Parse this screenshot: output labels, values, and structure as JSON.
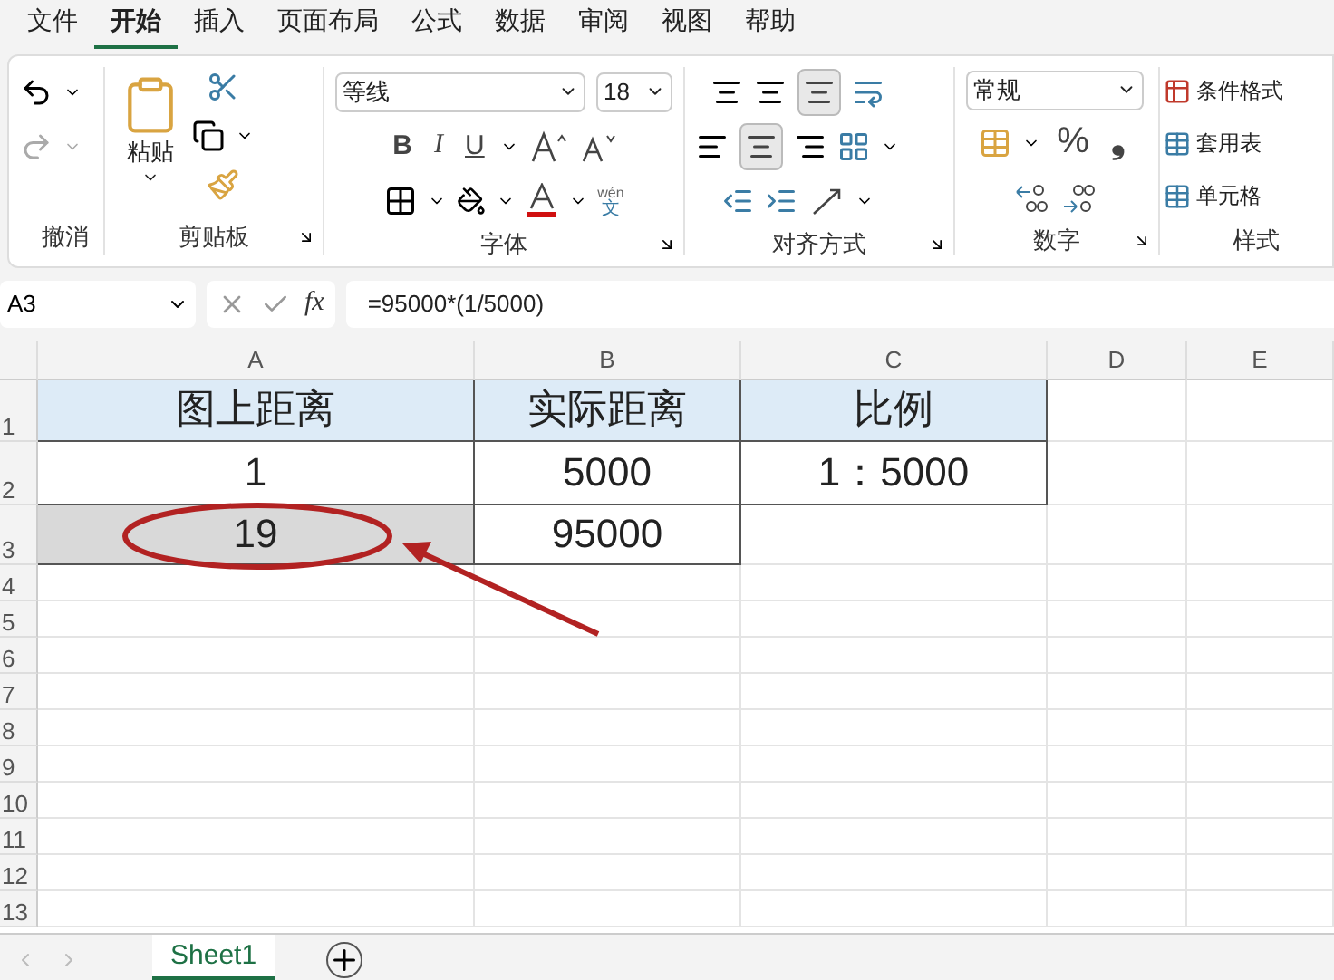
{
  "menu_tabs": [
    {
      "label": "文件",
      "selected": false
    },
    {
      "label": "开始",
      "selected": true
    },
    {
      "label": "插入",
      "selected": false
    },
    {
      "label": "页面布局",
      "selected": false
    },
    {
      "label": "公式",
      "selected": false
    },
    {
      "label": "数据",
      "selected": false
    },
    {
      "label": "审阅",
      "selected": false
    },
    {
      "label": "视图",
      "selected": false
    },
    {
      "label": "帮助",
      "selected": false
    }
  ],
  "ribbon": {
    "undo_group": "撤消",
    "clipboard": {
      "paste": "粘贴",
      "label": "剪贴板"
    },
    "font": {
      "name": "等线",
      "size": "18",
      "bold": "B",
      "italic": "I",
      "underline": "U",
      "phonetic_top": "wén",
      "phonetic_bottom": "文",
      "label": "字体"
    },
    "alignment": {
      "label": "对齐方式"
    },
    "number": {
      "format": "常规",
      "percent": "%",
      "comma": "❟",
      "label": "数字"
    },
    "styles": {
      "items": [
        "条件格式",
        "套用表",
        "单元格"
      ],
      "label": "样式"
    }
  },
  "formula_bar": {
    "name_box": "A3",
    "fx": "fx",
    "formula": "=95000*(1/5000)"
  },
  "sheet": {
    "columns": [
      "A",
      "B",
      "C",
      "D",
      "E"
    ],
    "rows": [
      {
        "number": "1",
        "header": true,
        "cells": [
          {
            "text": "图上距离",
            "selected": false
          },
          {
            "text": "实际距离",
            "selected": false
          },
          {
            "text": "比例",
            "selected": false
          }
        ]
      },
      {
        "number": "2",
        "cells": [
          {
            "text": "1",
            "selected": false
          },
          {
            "text": "5000",
            "selected": false
          },
          {
            "text": "1：5000",
            "selected": false
          }
        ]
      },
      {
        "number": "3",
        "cells": [
          {
            "text": "19",
            "selected": true
          },
          {
            "text": "95000",
            "selected": false
          }
        ]
      },
      {
        "number": "4",
        "cells": []
      },
      {
        "number": "5",
        "cells": []
      },
      {
        "number": "6",
        "cells": []
      },
      {
        "number": "7",
        "cells": []
      },
      {
        "number": "8",
        "cells": []
      },
      {
        "number": "9",
        "cells": []
      },
      {
        "number": "10",
        "cells": []
      },
      {
        "number": "11",
        "cells": []
      },
      {
        "number": "12",
        "cells": []
      },
      {
        "number": "13",
        "cells": []
      }
    ]
  },
  "sheet_tabs": [
    {
      "label": "Sheet1",
      "selected": true
    }
  ]
}
